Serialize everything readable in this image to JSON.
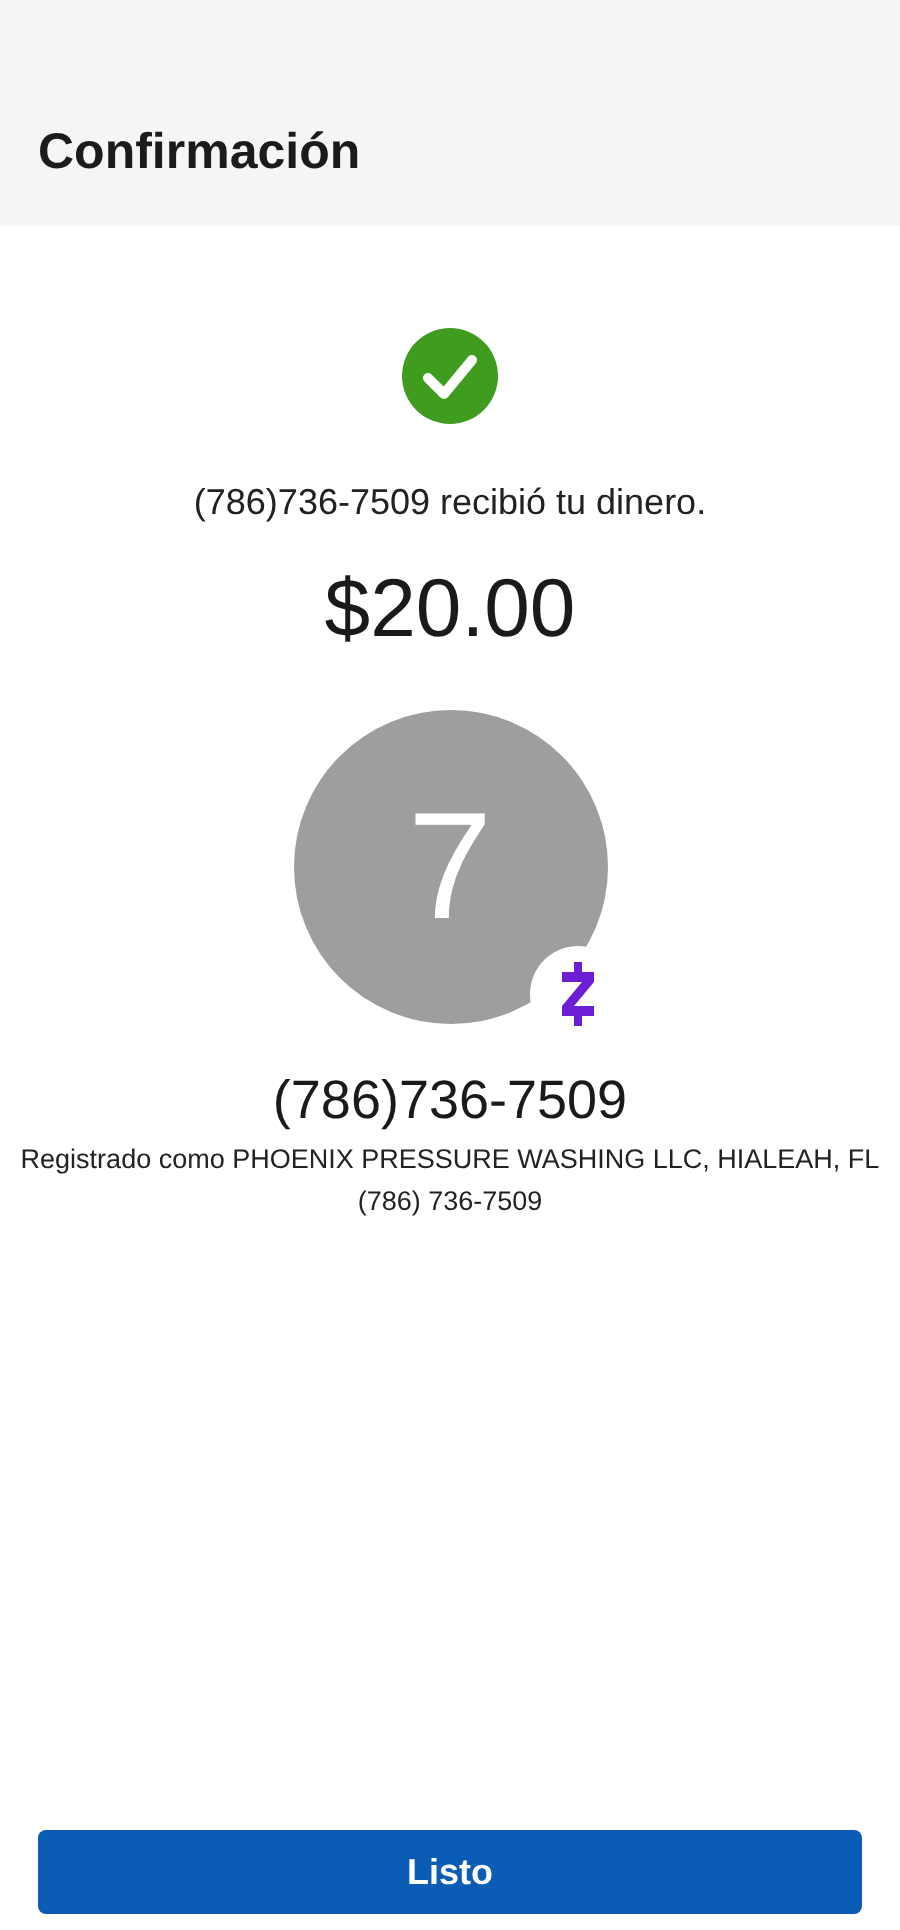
{
  "header": {
    "title": "Confirmación"
  },
  "confirmation": {
    "message": "(786)736-7509 recibió tu dinero.",
    "amount": "$20.00"
  },
  "recipient": {
    "avatar_initial": "7",
    "name": "(786)736-7509",
    "registered_as": "Registrado como PHOENIX PRESSURE WASHING LLC, HIALEAH, FL",
    "phone": "(786) 736-7509"
  },
  "buttons": [
    {
      "label": "Listo",
      "kind": "primary"
    }
  ]
}
